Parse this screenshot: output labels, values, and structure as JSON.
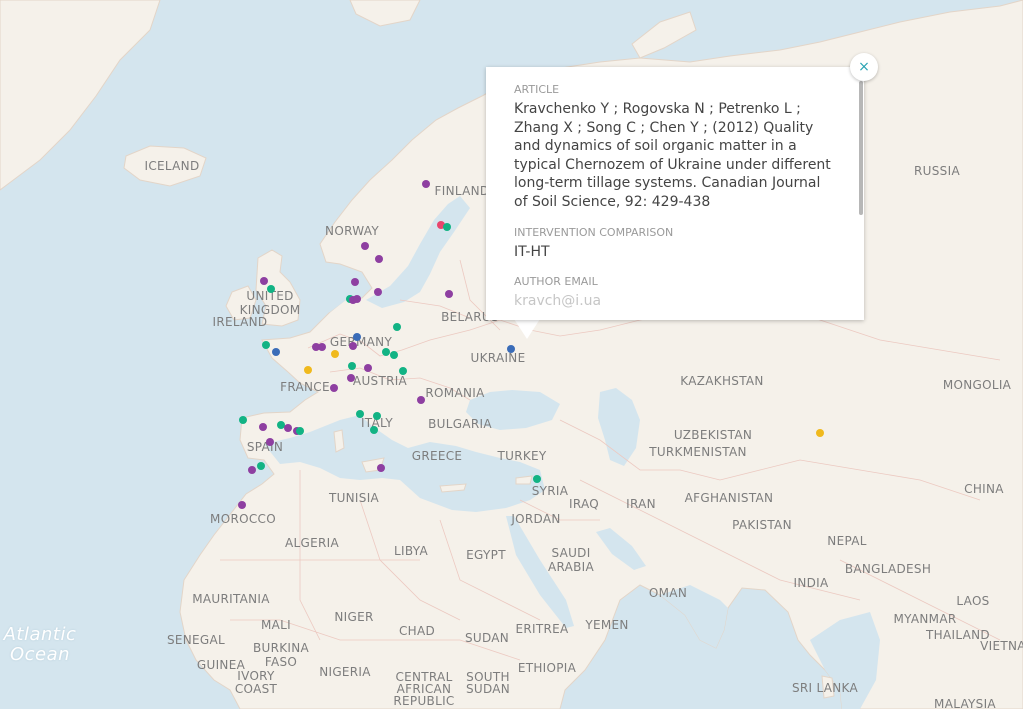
{
  "map": {
    "labels": [
      {
        "text": "ICELAND"
      },
      {
        "text": "FINLAND"
      },
      {
        "text": "NORWAY"
      },
      {
        "text": "UNITED"
      },
      {
        "text": "KINGDOM"
      },
      {
        "text": "IRELAND"
      },
      {
        "text": "BELARUS"
      },
      {
        "text": "GERMANY"
      },
      {
        "text": "UKRAINE"
      },
      {
        "text": "FRANCE"
      },
      {
        "text": "AUSTRIA"
      },
      {
        "text": "ROMANIA"
      },
      {
        "text": "KAZAKHSTAN"
      },
      {
        "text": "RUSSIA"
      },
      {
        "text": "MONGOLIA"
      },
      {
        "text": "ITALY"
      },
      {
        "text": "BULGARIA"
      },
      {
        "text": "SPAIN"
      },
      {
        "text": "GREECE"
      },
      {
        "text": "TURKEY"
      },
      {
        "text": "UZBEKISTAN"
      },
      {
        "text": "TURKMENISTAN"
      },
      {
        "text": "SYRIA"
      },
      {
        "text": "IRAQ"
      },
      {
        "text": "IRAN"
      },
      {
        "text": "AFGHANISTAN"
      },
      {
        "text": "CHINA"
      },
      {
        "text": "TUNISIA"
      },
      {
        "text": "JORDAN"
      },
      {
        "text": "MOROCCO"
      },
      {
        "text": "PAKISTAN"
      },
      {
        "text": "ALGERIA"
      },
      {
        "text": "LIBYA"
      },
      {
        "text": "EGYPT"
      },
      {
        "text": "SAUDI"
      },
      {
        "text": "ARABIA"
      },
      {
        "text": "NEPAL"
      },
      {
        "text": "BANGLADESH"
      },
      {
        "text": "INDIA"
      },
      {
        "text": "OMAN"
      },
      {
        "text": "MAURITANIA"
      },
      {
        "text": "MALI"
      },
      {
        "text": "NIGER"
      },
      {
        "text": "CHAD"
      },
      {
        "text": "SUDAN"
      },
      {
        "text": "ERITREA"
      },
      {
        "text": "YEMEN"
      },
      {
        "text": "LAOS"
      },
      {
        "text": "MYANMAR"
      },
      {
        "text": "THAILAND"
      },
      {
        "text": "VIETNA"
      },
      {
        "text": "SENEGAL"
      },
      {
        "text": "BURKINA"
      },
      {
        "text": "FASO"
      },
      {
        "text": "GUINEA"
      },
      {
        "text": "IVORY"
      },
      {
        "text": "COAST"
      },
      {
        "text": "NIGERIA"
      },
      {
        "text": "CENTRAL"
      },
      {
        "text": "AFRICAN"
      },
      {
        "text": "REPUBLIC"
      },
      {
        "text": "SOUTH"
      },
      {
        "text": "SUDAN"
      },
      {
        "text": "ETHIOPIA"
      },
      {
        "text": "SRI LANKA"
      },
      {
        "text": "MALAYSIA"
      }
    ],
    "ocean_label": {
      "line1": "Atlantic",
      "line2": "Ocean"
    },
    "colors": {
      "purple": "#8e3fa1",
      "teal": "#12b384",
      "blue": "#3a6cb8",
      "yellow": "#f0b91d",
      "pink": "#e8466d"
    }
  },
  "popup": {
    "fields": [
      {
        "label": "ARTICLE",
        "value": "Kravchenko Y ; Rogovska N ; Petrenko L ; Zhang X ; Song C ; Chen Y ; (2012) Quality and dynamics of soil organic matter in a typical Chernozem of Ukraine under different long-term tillage systems. Canadian Journal of Soil Science, 92: 429-438"
      },
      {
        "label": "INTERVENTION COMPARISON",
        "value": "IT-HT"
      },
      {
        "label": "AUTHOR EMAIL",
        "value": "kravch@i.ua"
      }
    ],
    "close_label": "×"
  }
}
